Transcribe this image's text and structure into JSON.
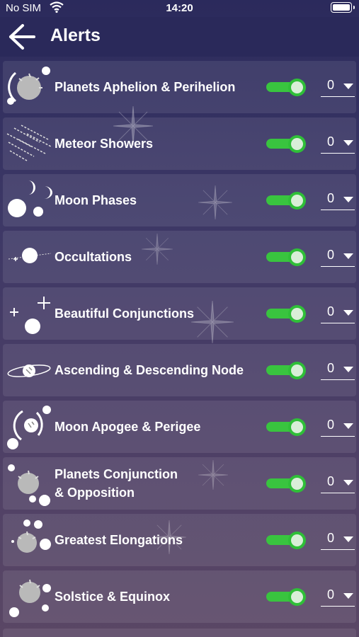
{
  "status": {
    "carrier": "No SIM",
    "time": "14:20"
  },
  "header": {
    "title": "Alerts"
  },
  "alerts": [
    {
      "label": "Planets Aphelion & Perihelion",
      "icon": "planet-orbit-icon",
      "enabled": true,
      "value": "0"
    },
    {
      "label": "Meteor Showers",
      "icon": "meteor-shower-icon",
      "enabled": true,
      "value": "0"
    },
    {
      "label": "Moon Phases",
      "icon": "moon-phases-icon",
      "enabled": true,
      "value": "0"
    },
    {
      "label": "Occultations",
      "icon": "occultation-icon",
      "enabled": true,
      "value": "0"
    },
    {
      "label": "Beautiful Conjunctions",
      "icon": "conjunction-icon",
      "enabled": true,
      "value": "0"
    },
    {
      "label": "Ascending & Descending Node",
      "icon": "node-orbit-icon",
      "enabled": true,
      "value": "0"
    },
    {
      "label": "Moon Apogee & Perigee",
      "icon": "moon-apogee-icon",
      "enabled": true,
      "value": "0"
    },
    {
      "label": "Planets Conjunction & Opposition",
      "icon": "planet-conjunction-icon",
      "enabled": true,
      "value": "0"
    },
    {
      "label": "Greatest Elongations",
      "icon": "elongation-icon",
      "enabled": true,
      "value": "0"
    },
    {
      "label": "Solstice & Equinox",
      "icon": "solstice-equinox-icon",
      "enabled": true,
      "value": "0"
    }
  ],
  "colors": {
    "toggle_on": "#39c43f",
    "nav_bg": "#2a295a"
  }
}
